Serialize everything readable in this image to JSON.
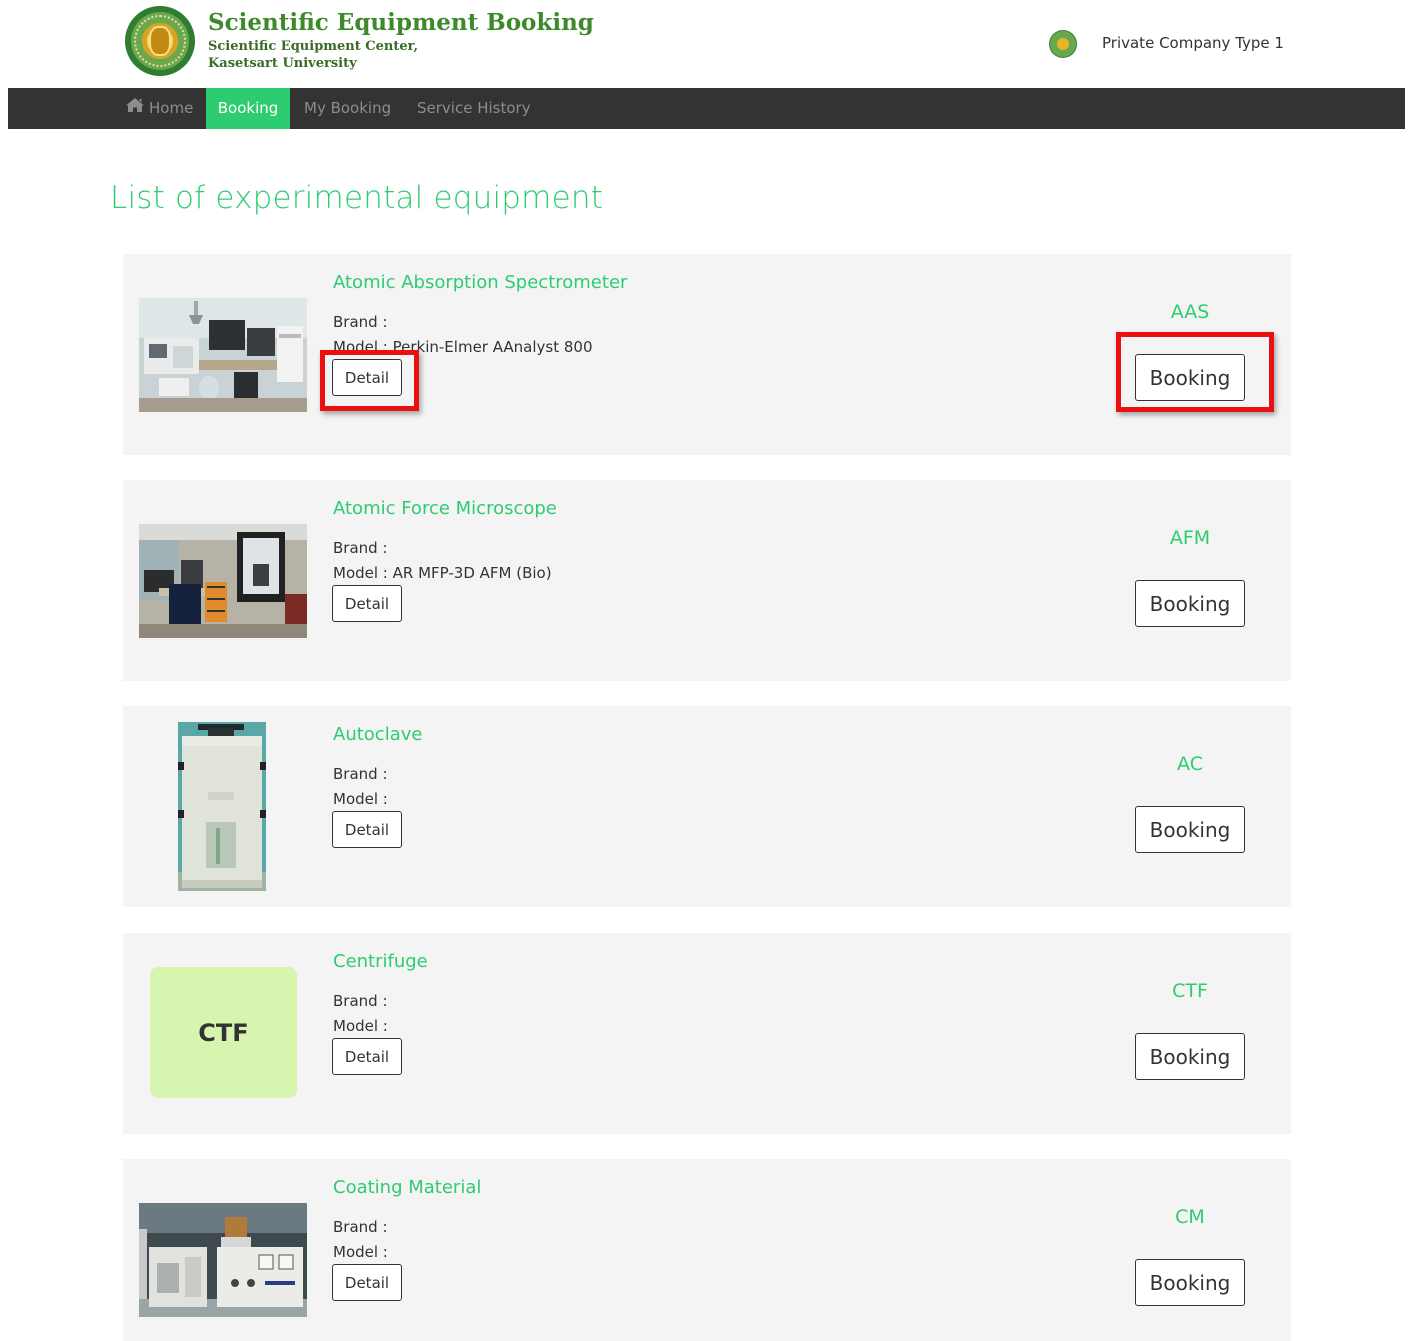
{
  "header": {
    "title": "Scientific Equipment Booking",
    "subtitle_line1": "Scientific Equipment Center,",
    "subtitle_line2": "Kasetsart University",
    "user_name": "Private Company Type 1"
  },
  "nav": {
    "home": "Home",
    "booking": "Booking",
    "my_booking": "My Booking",
    "service_history": "Service History",
    "active": "Booking"
  },
  "page_title": "List of experimental equipment",
  "equipment": [
    {
      "name": "Atomic Absorption Spectrometer",
      "brand": "Brand :",
      "model": "Model : Perkin-Elmer AAnalyst 800",
      "detail": "Detail",
      "code": "AAS",
      "booking": "Booking"
    },
    {
      "name": "Atomic Force Microscope",
      "brand": "Brand :",
      "model": "Model : AR MFP-3D AFM (Bio)",
      "detail": "Detail",
      "code": "AFM",
      "booking": "Booking"
    },
    {
      "name": "Autoclave",
      "brand": "Brand :",
      "model": "Model :",
      "detail": "Detail",
      "code": "AC",
      "booking": "Booking"
    },
    {
      "name": "Centrifuge",
      "brand": "Brand :",
      "model": "Model :",
      "detail": "Detail",
      "code": "CTF",
      "booking": "Booking",
      "tile_text": "CTF"
    },
    {
      "name": "Coating Material",
      "brand": "Brand :",
      "model": "Model :",
      "detail": "Detail",
      "code": "CM",
      "booking": "Booking"
    }
  ],
  "colors": {
    "accent": "#2ecc71",
    "navbar": "#333333",
    "card_bg": "#f4f4f4",
    "highlight": "#e81010",
    "tile_bg": "#d8f5b0"
  },
  "icons": {
    "home": "home-icon"
  }
}
